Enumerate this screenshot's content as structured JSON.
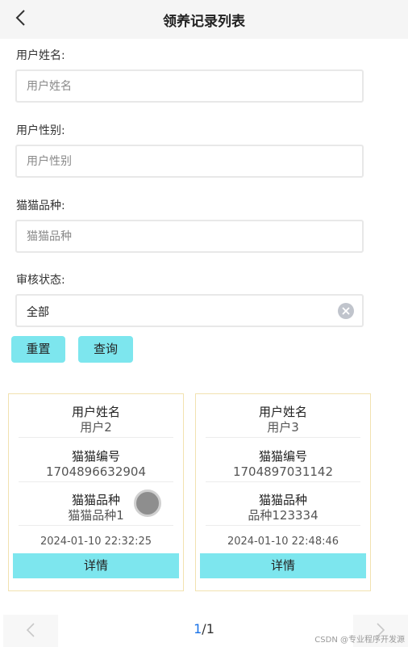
{
  "header": {
    "title": "领养记录列表",
    "back_icon": "chevron-left-icon"
  },
  "filters": {
    "username": {
      "label": "用户姓名:",
      "placeholder": "用户姓名"
    },
    "gender": {
      "label": "用户性别:",
      "placeholder": "用户性别"
    },
    "breed": {
      "label": "猫猫品种:",
      "placeholder": "猫猫品种"
    },
    "status": {
      "label": "审核状态:",
      "value": "全部",
      "clear_icon": "clear-icon"
    }
  },
  "buttons": {
    "reset": "重置",
    "query": "查询"
  },
  "records": [
    {
      "name_label": "用户姓名",
      "name": "用户2",
      "cat_no_label": "猫猫编号",
      "cat_no": "1704896632904",
      "breed_label": "猫猫品种",
      "breed": "猫猫品种1",
      "time": "2024-01-10 22:32:25",
      "detail": "详情"
    },
    {
      "name_label": "用户姓名",
      "name": "用户3",
      "cat_no_label": "猫猫编号",
      "cat_no": "1704897031142",
      "breed_label": "猫猫品种",
      "breed": "品种123334",
      "time": "2024-01-10 22:48:46",
      "detail": "详情"
    }
  ],
  "pagination": {
    "current": "1",
    "total": "/1"
  },
  "watermark": "CSDN @专业程序开发源",
  "colors": {
    "accent": "#7de6ee",
    "card_border": "#f2e2b0",
    "page_link": "#1a73e8"
  }
}
